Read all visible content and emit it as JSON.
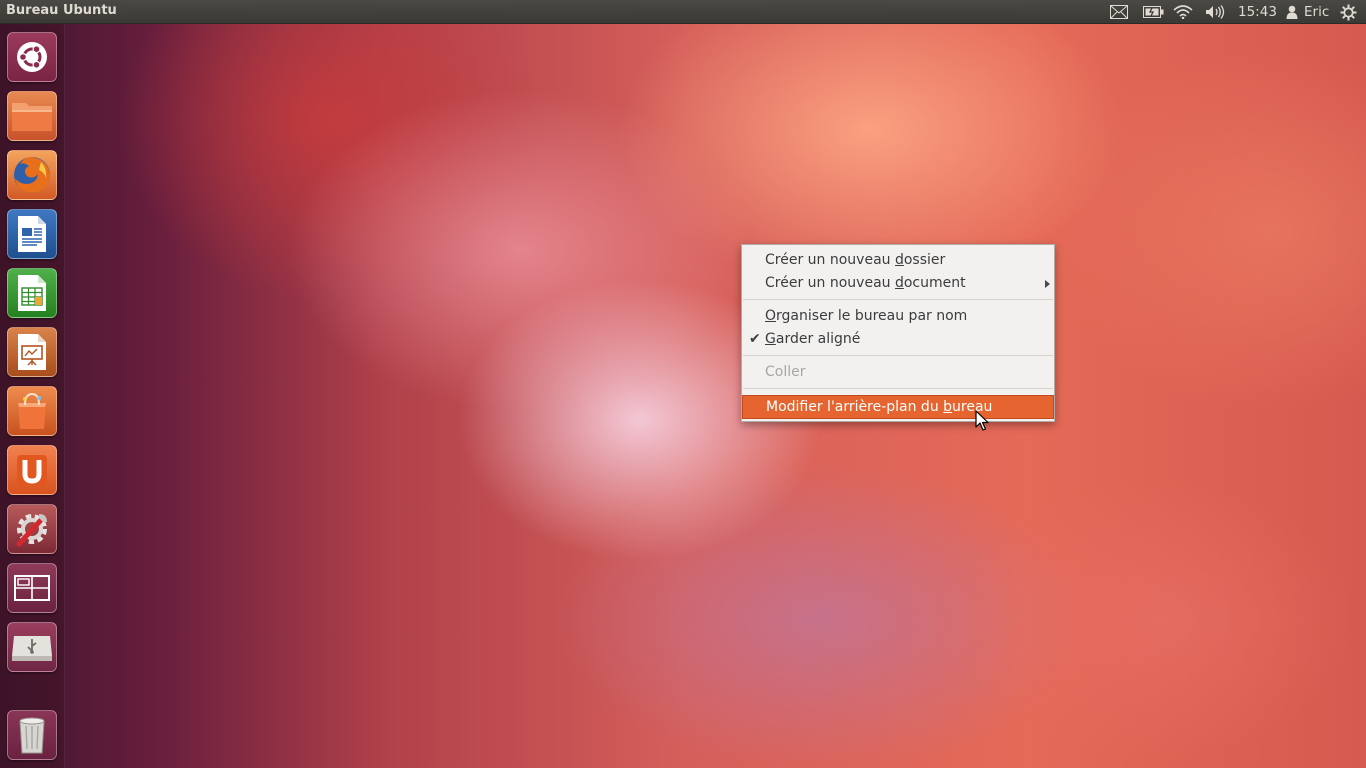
{
  "top_panel": {
    "title": "Bureau Ubuntu",
    "clock": "15:43",
    "user_name": "Eric",
    "indicators": [
      "mail-icon",
      "battery-icon",
      "wifi-icon",
      "volume-icon",
      "user-icon",
      "session-gear-icon"
    ]
  },
  "launcher": {
    "items": [
      {
        "name": "dash-home",
        "icon": "ubuntu-logo-icon"
      },
      {
        "name": "files",
        "icon": "folder-icon"
      },
      {
        "name": "firefox",
        "icon": "firefox-icon"
      },
      {
        "name": "libreoffice-writer",
        "icon": "writer-icon"
      },
      {
        "name": "libreoffice-calc",
        "icon": "calc-icon"
      },
      {
        "name": "libreoffice-impress",
        "icon": "impress-icon"
      },
      {
        "name": "software-center",
        "icon": "shopping-bag-icon"
      },
      {
        "name": "ubuntu-one",
        "icon": "ubuntu-one-icon"
      },
      {
        "name": "system-settings",
        "icon": "settings-icon"
      },
      {
        "name": "workspace-switcher",
        "icon": "workspaces-icon"
      },
      {
        "name": "usb-drive",
        "icon": "usb-drive-icon"
      },
      {
        "name": "trash",
        "icon": "trash-icon"
      }
    ]
  },
  "context_menu": {
    "new_folder": {
      "pre": "Créer un nouveau ",
      "accel": "d",
      "post": "ossier"
    },
    "new_document": {
      "pre": "Créer un nouveau ",
      "accel": "d",
      "post": "ocument"
    },
    "organize": {
      "pre": "",
      "accel": "O",
      "post": "rganiser le bureau par nom"
    },
    "keep_aligned": {
      "pre": "",
      "accel": "G",
      "post": "arder aligné",
      "checked": true
    },
    "paste": {
      "label": "Coller",
      "enabled": false
    },
    "change_background": {
      "pre": "Modifier l'arrière-plan du ",
      "accel": "b",
      "post": "ureau",
      "highlighted": true
    }
  },
  "colors": {
    "highlight": "#e5642f",
    "panel": "#3c3b37",
    "menu_bg": "#f2f1f0"
  }
}
